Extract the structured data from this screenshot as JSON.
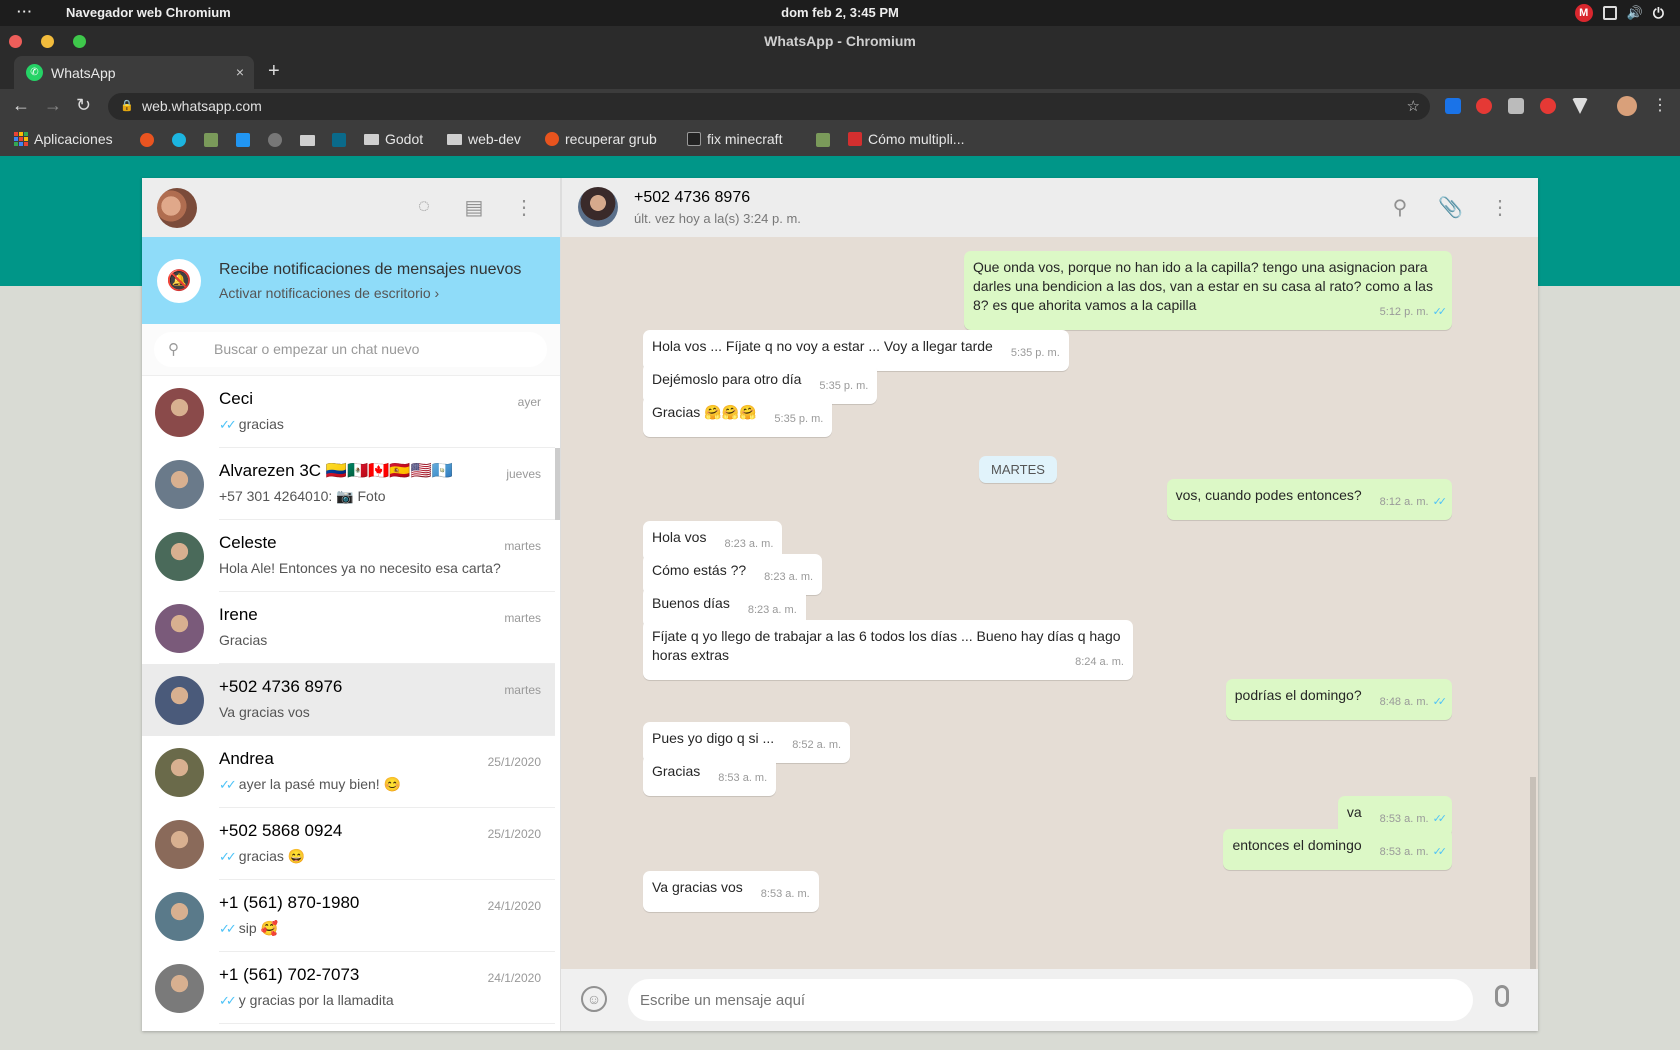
{
  "os": {
    "menu_dots": "···",
    "app_name": "Navegador web Chromium",
    "clock": "dom feb  2,  3:45 PM",
    "mega_label": "M"
  },
  "window": {
    "title": "WhatsApp - Chromium"
  },
  "tab": {
    "label": "WhatsApp",
    "close": "×",
    "new": "+"
  },
  "address": {
    "url": "web.whatsapp.com"
  },
  "bookmarks": [
    "Aplicaciones",
    "Godot",
    "web-dev",
    "recuperar grub",
    "fix minecraft",
    "Cómo multipli..."
  ],
  "sidebar": {
    "notification_title": "Recibe notificaciones de mensajes nuevos",
    "notification_link": "Activar notificaciones de escritorio ›",
    "search_placeholder": "Buscar o empezar un chat nuevo",
    "chats": [
      {
        "name": "Ceci",
        "time": "ayer",
        "preview": "gracias",
        "ticks": true
      },
      {
        "name": "Alvarezen 3C 🇨🇴🇲🇽🇨🇦🇪🇸🇺🇸🇬🇹",
        "time": "jueves",
        "preview": "+57 301 4264010: 📷 Foto",
        "ticks": false
      },
      {
        "name": "Celeste",
        "time": "martes",
        "preview": "Hola Ale! Entonces ya no necesito esa carta?",
        "ticks": false
      },
      {
        "name": "Irene",
        "time": "martes",
        "preview": "Gracias",
        "ticks": false
      },
      {
        "name": "+502 4736 8976",
        "time": "martes",
        "preview": "Va gracias vos",
        "ticks": false,
        "selected": true
      },
      {
        "name": "Andrea",
        "time": "25/1/2020",
        "preview": "ayer la pasé muy bien! 😊",
        "ticks": true
      },
      {
        "name": "+502 5868 0924",
        "time": "25/1/2020",
        "preview": "gracias 😄",
        "ticks": true
      },
      {
        "name": "+1 (561) 870-1980",
        "time": "24/1/2020",
        "preview": "sip 🥰",
        "ticks": true
      },
      {
        "name": "+1 (561) 702-7073",
        "time": "24/1/2020",
        "preview": "y gracias por la llamadita",
        "ticks": true
      }
    ]
  },
  "conversation": {
    "contact": "+502 4736 8976",
    "status": "últ. vez hoy a la(s) 3:24 p. m.",
    "day_label": "MARTES",
    "composer_placeholder": "Escribe un mensaje aquí",
    "messages": [
      {
        "dir": "out",
        "text": "Que onda vos, porque no han ido a la capilla? tengo una asignacion para darles una bendicion a las dos, van a estar en su casa al rato? como a las 8? es que ahorita vamos a la capilla",
        "time": "5:12 p. m."
      },
      {
        "dir": "in",
        "text": "Hola vos ... Fíjate q no voy a estar ... Voy a llegar tarde",
        "time": "5:35 p. m."
      },
      {
        "dir": "in",
        "text": "Dejémoslo para otro día",
        "time": "5:35 p. m."
      },
      {
        "dir": "in",
        "text": "Gracias 🤗🤗🤗",
        "time": "5:35 p. m."
      },
      {
        "dir": "out",
        "text": "vos, cuando podes entonces?",
        "time": "8:12 a. m."
      },
      {
        "dir": "in",
        "text": "Hola vos",
        "time": "8:23 a. m."
      },
      {
        "dir": "in",
        "text": "Cómo estás ??",
        "time": "8:23 a. m."
      },
      {
        "dir": "in",
        "text": "Buenos días",
        "time": "8:23 a. m."
      },
      {
        "dir": "in",
        "text": "Fíjate q yo llego de trabajar a las 6 todos los días ... Bueno hay días q hago horas extras",
        "time": "8:24 a. m."
      },
      {
        "dir": "out",
        "text": "podrías el domingo?",
        "time": "8:48 a. m."
      },
      {
        "dir": "in",
        "text": "Pues yo digo q si ...",
        "time": "8:52 a. m."
      },
      {
        "dir": "in",
        "text": "Gracias",
        "time": "8:53 a. m."
      },
      {
        "dir": "out",
        "text": "va",
        "time": "8:53 a. m."
      },
      {
        "dir": "out",
        "text": "entonces el domingo",
        "time": "8:53 a. m."
      },
      {
        "dir": "in",
        "text": "Va gracias vos",
        "time": "8:53 a. m."
      }
    ]
  },
  "colors": {
    "teal": "#009688",
    "outgoing": "#dcf8c6",
    "incoming": "#ffffff",
    "chat_bg": "#e5ddd5",
    "read_tick": "#4fc3f7"
  }
}
